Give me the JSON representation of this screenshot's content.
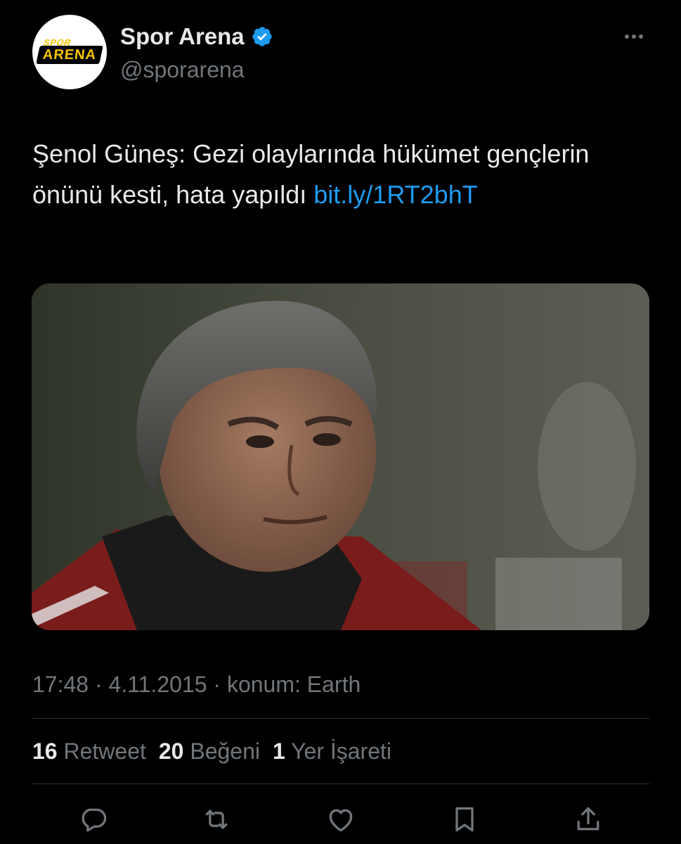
{
  "account": {
    "display_name": "Spor Arena",
    "handle": "@sporarena",
    "verified": true,
    "avatar_logo_top": "SPOR",
    "avatar_logo_main": "ARENA"
  },
  "tweet": {
    "text": "Şenol Güneş: Gezi olaylarında hükümet gençlerin önünü kesti, hata yapıldı ",
    "link": "bit.ly/1RT2bhT",
    "timestamp": "17:48 · 4.11.2015 · konum: Earth"
  },
  "stats": {
    "retweets_count": "16",
    "retweets_label": "Retweet",
    "likes_count": "20",
    "likes_label": "Beğeni",
    "bookmarks_count": "1",
    "bookmarks_label": "Yer İşareti"
  },
  "colors": {
    "background": "#000000",
    "text": "#e7e9ea",
    "secondary_text": "#71767b",
    "link": "#1d9bf0",
    "divider": "#2f3336",
    "verified_badge": "#1d9bf0"
  },
  "icons": [
    "more-icon",
    "verified-badge-icon",
    "reply-icon",
    "retweet-icon",
    "like-icon",
    "bookmark-icon",
    "share-icon"
  ]
}
